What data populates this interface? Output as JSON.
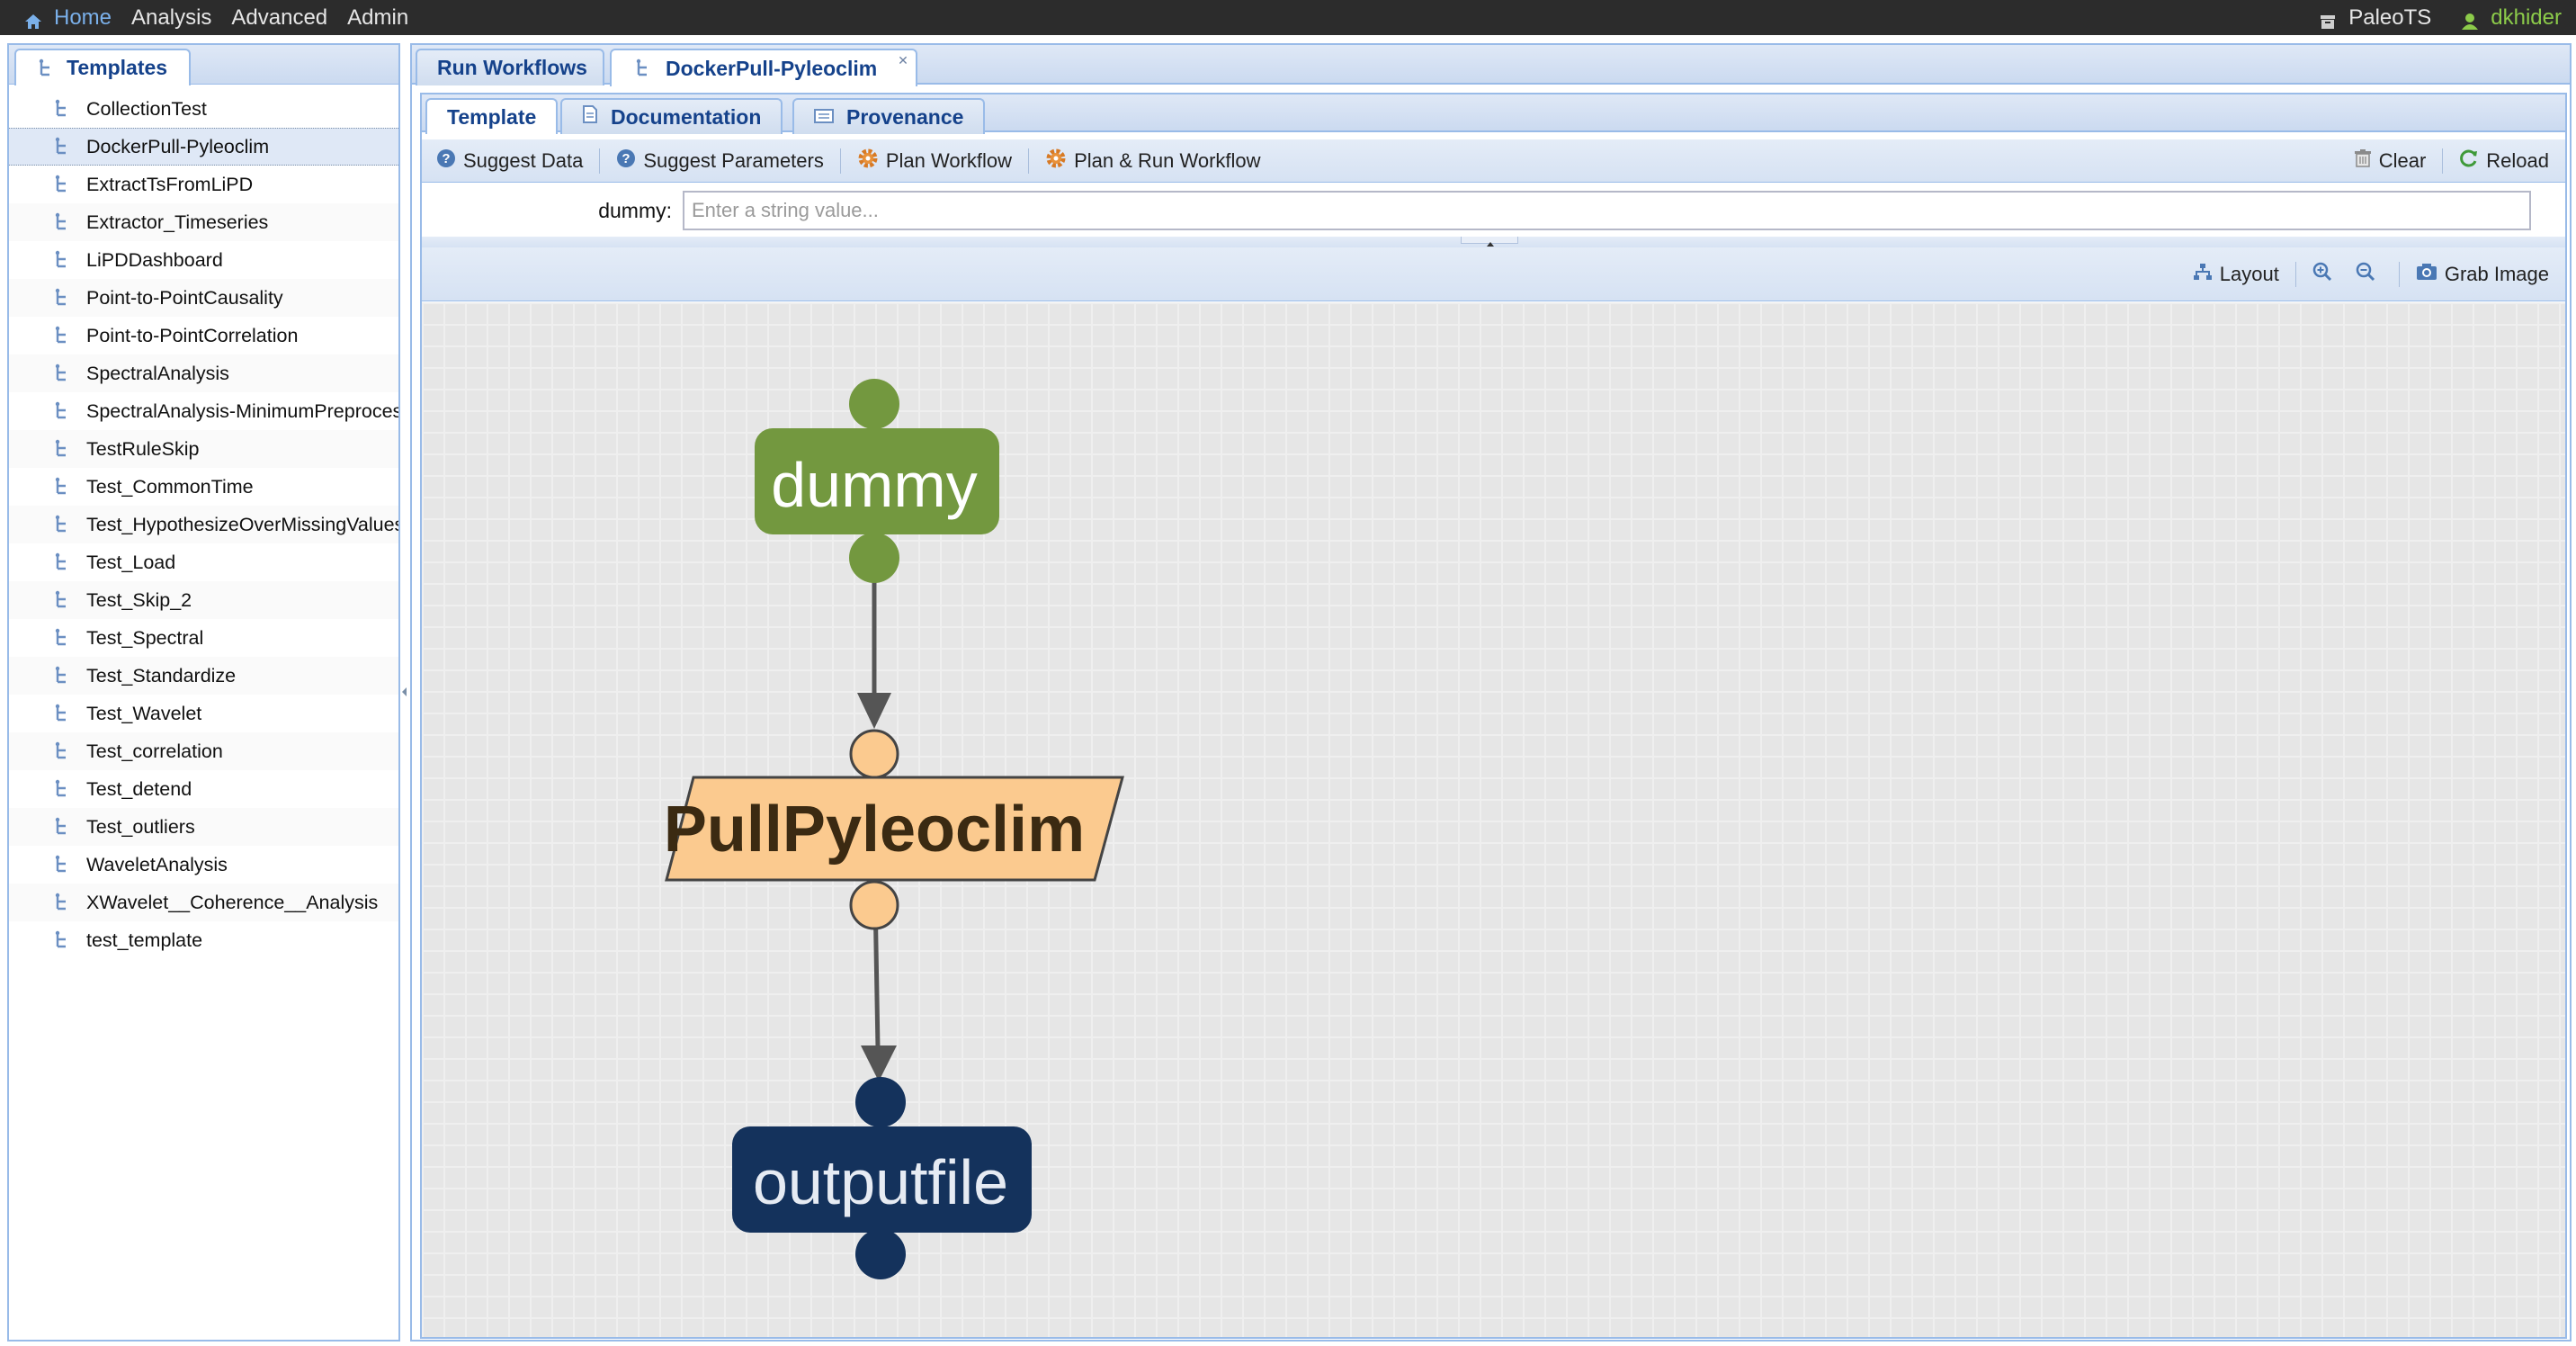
{
  "nav": {
    "home": "Home",
    "analysis": "Analysis",
    "advanced": "Advanced",
    "admin": "Admin",
    "project": "PaleoTS",
    "user": "dkhider"
  },
  "left_panel": {
    "tab_label": "Templates",
    "items": [
      {
        "label": "CollectionTest"
      },
      {
        "label": "DockerPull-Pyleoclim",
        "selected": true
      },
      {
        "label": "ExtractTsFromLiPD"
      },
      {
        "label": "Extractor_Timeseries"
      },
      {
        "label": "LiPDDashboard"
      },
      {
        "label": "Point-to-PointCausality"
      },
      {
        "label": "Point-to-PointCorrelation"
      },
      {
        "label": "SpectralAnalysis"
      },
      {
        "label": "SpectralAnalysis-MinimumPreprocess"
      },
      {
        "label": "TestRuleSkip"
      },
      {
        "label": "Test_CommonTime"
      },
      {
        "label": "Test_HypothesizeOverMissingValues"
      },
      {
        "label": "Test_Load"
      },
      {
        "label": "Test_Skip_2"
      },
      {
        "label": "Test_Spectral"
      },
      {
        "label": "Test_Standardize"
      },
      {
        "label": "Test_Wavelet"
      },
      {
        "label": "Test_correlation"
      },
      {
        "label": "Test_detend"
      },
      {
        "label": "Test_outliers"
      },
      {
        "label": "WaveletAnalysis"
      },
      {
        "label": "XWavelet__Coherence__Analysis"
      },
      {
        "label": "test_template"
      }
    ]
  },
  "outer_tabs": [
    {
      "label": "Run Workflows"
    },
    {
      "label": "DockerPull-Pyleoclim",
      "active": true
    }
  ],
  "inner_tabs": [
    {
      "label": "Template",
      "active": true
    },
    {
      "label": "Documentation"
    },
    {
      "label": "Provenance"
    }
  ],
  "toolbar": {
    "suggest_data": "Suggest Data",
    "suggest_parameters": "Suggest Parameters",
    "plan_workflow": "Plan Workflow",
    "plan_run_workflow": "Plan & Run Workflow",
    "clear": "Clear",
    "reload": "Reload"
  },
  "form": {
    "dummy_label": "dummy:",
    "dummy_placeholder": "Enter a string value...",
    "dummy_value": ""
  },
  "canvas_toolbar": {
    "layout": "Layout",
    "grab_image": "Grab Image"
  },
  "graph": {
    "nodes": [
      {
        "label": "dummy",
        "kind": "parameter",
        "color": "#73983f"
      },
      {
        "label": "PullPyleoclim",
        "kind": "component",
        "color": "#fbca8f"
      },
      {
        "label": "outputfile",
        "kind": "output-data",
        "color": "#14325c"
      }
    ],
    "edges": [
      {
        "from": "dummy",
        "to": "PullPyleoclim"
      },
      {
        "from": "PullPyleoclim",
        "to": "outputfile"
      }
    ]
  },
  "colors": {
    "accent": "#15428b",
    "topbar": "#2c2c2c",
    "user": "#8ccb4a",
    "border": "#99bbe8"
  }
}
